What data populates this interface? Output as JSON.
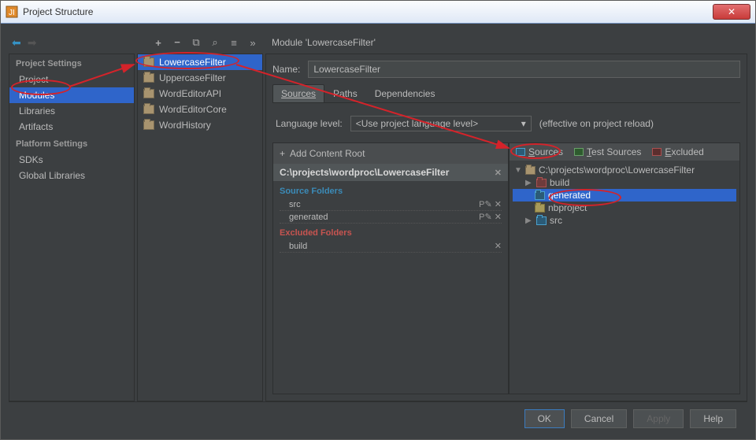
{
  "window": {
    "title": "Project Structure"
  },
  "nav": {
    "section1": "Project Settings",
    "items1": [
      "Project",
      "Modules",
      "Libraries",
      "Artifacts"
    ],
    "section2": "Platform Settings",
    "items2": [
      "SDKs",
      "Global Libraries"
    ]
  },
  "modules": {
    "items": [
      "LowercaseFilter",
      "UppercaseFilter",
      "WordEditorAPI",
      "WordEditorCore",
      "WordHistory"
    ]
  },
  "module": {
    "header": "Module 'LowercaseFilter'",
    "name_label": "Name:",
    "name_value": "LowercaseFilter",
    "tabs": [
      "Sources",
      "Paths",
      "Dependencies"
    ],
    "lang_label": "Language level:",
    "lang_value": "<Use project language level>",
    "lang_hint": "(effective on project reload)",
    "add_root": "Add Content Root",
    "root_path": "C:\\projects\\wordproc\\LowercaseFilter",
    "src_folders_title": "Source Folders",
    "src_folders": [
      "src",
      "generated"
    ],
    "exc_folders_title": "Excluded Folders",
    "exc_folders": [
      "build"
    ],
    "marks": {
      "sources": "Sources",
      "tests": "Test Sources",
      "excluded": "Excluded"
    },
    "tree": {
      "root": "C:\\projects\\wordproc\\LowercaseFilter",
      "children": [
        "build",
        "generated",
        "nbproject",
        "src"
      ]
    }
  },
  "buttons": {
    "ok": "OK",
    "cancel": "Cancel",
    "apply": "Apply",
    "help": "Help"
  }
}
